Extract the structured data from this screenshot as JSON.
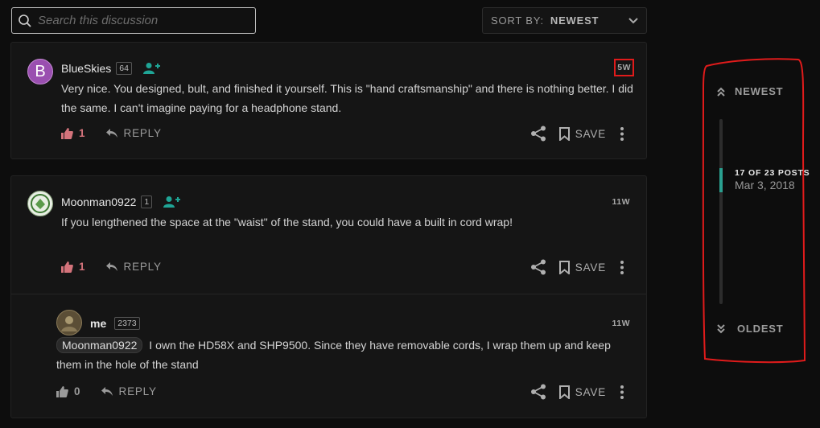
{
  "search": {
    "placeholder": "Search this discussion"
  },
  "sort": {
    "label": "SORT BY:",
    "value": "NEWEST"
  },
  "posts": [
    {
      "avatar_letter": "B",
      "username": "BlueSkies",
      "rep": "64",
      "time": "5W",
      "body": "Very nice. You designed, bult, and finished it yourself. This is \"hand craftsmanship\" and there is nothing better. I did the same. I can't imagine paying for a headphone stand.",
      "likes": "1",
      "reply_label": "REPLY",
      "save_label": "SAVE"
    },
    {
      "username": "Moonman0922",
      "rep": "1",
      "time": "11W",
      "body": "If you lengthened the space at the \"waist\" of the stand, you could have a built in cord wrap!",
      "likes": "1",
      "reply_label": "REPLY",
      "save_label": "SAVE"
    },
    {
      "username": "me",
      "rep": "2373",
      "time": "11W",
      "mention": "Moonman0922",
      "body": "I own the HD58X and SHP9500. Since they have removable cords, I wrap them up and keep them in the hole of the stand",
      "likes": "0",
      "reply_label": "REPLY",
      "save_label": "SAVE"
    }
  ],
  "timeline": {
    "newest": "NEWEST",
    "oldest": "OLDEST",
    "position": "17 OF 23 POSTS",
    "date": "Mar 3, 2018",
    "position_fraction": 0.27
  },
  "colors": {
    "accent": "#2aa090",
    "like": "#d4737b",
    "annotation": "#e01b1b",
    "follow": "#1fa596"
  }
}
